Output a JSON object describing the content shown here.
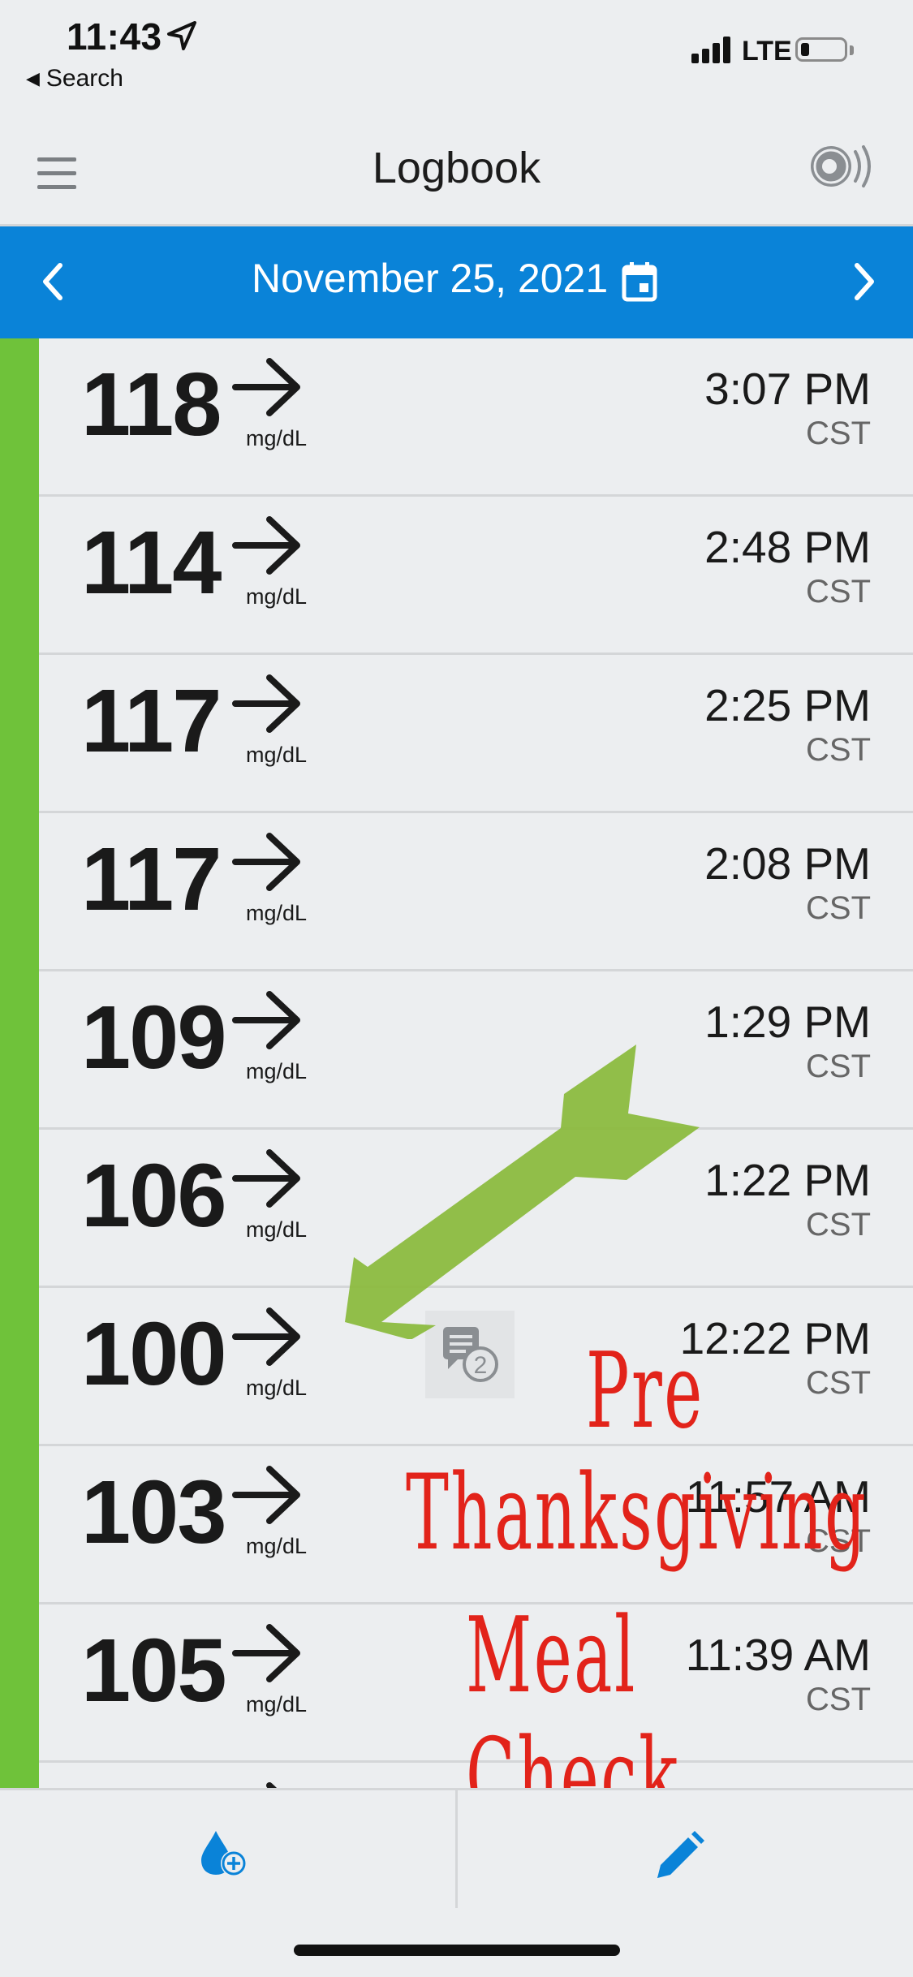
{
  "status_bar": {
    "time": "11:43",
    "back_label": "Search",
    "network": "LTE"
  },
  "header": {
    "title": "Logbook",
    "menu_icon": "hamburger-icon",
    "sensor_icon": "sensor-scan-icon"
  },
  "date_bar": {
    "date": "November 25, 2021",
    "prev_icon": "chevron-left-icon",
    "next_icon": "chevron-right-icon",
    "calendar_icon": "calendar-icon",
    "color": "#0a83d8"
  },
  "range_color": "#6fc23a",
  "readings": [
    {
      "value": "118",
      "unit": "mg/dL",
      "trend": "steady",
      "time": "3:07 PM",
      "tz": "CST"
    },
    {
      "value": "114",
      "unit": "mg/dL",
      "trend": "steady",
      "time": "2:48 PM",
      "tz": "CST"
    },
    {
      "value": "117",
      "unit": "mg/dL",
      "trend": "steady",
      "time": "2:25 PM",
      "tz": "CST"
    },
    {
      "value": "117",
      "unit": "mg/dL",
      "trend": "steady",
      "time": "2:08 PM",
      "tz": "CST"
    },
    {
      "value": "109",
      "unit": "mg/dL",
      "trend": "steady",
      "time": "1:29 PM",
      "tz": "CST"
    },
    {
      "value": "106",
      "unit": "mg/dL",
      "trend": "steady",
      "time": "1:22 PM",
      "tz": "CST"
    },
    {
      "value": "100",
      "unit": "mg/dL",
      "trend": "steady",
      "time": "12:22 PM",
      "tz": "CST",
      "notes": "2"
    },
    {
      "value": "103",
      "unit": "mg/dL",
      "trend": "steady",
      "time": "11:57 AM",
      "tz": "CST"
    },
    {
      "value": "105",
      "unit": "mg/dL",
      "trend": "steady",
      "time": "11:39 AM",
      "tz": "CST"
    }
  ],
  "annotation": {
    "line1": "Pre",
    "line2": "Thanksgiving",
    "line3": "Meal Check",
    "text_color": "#e2231a",
    "arrow_color": "#8cbb3f"
  },
  "toolbar": {
    "left_icon": "add-blood-glucose-icon",
    "right_icon": "pencil-edit-icon",
    "icon_color": "#0a83d8"
  }
}
